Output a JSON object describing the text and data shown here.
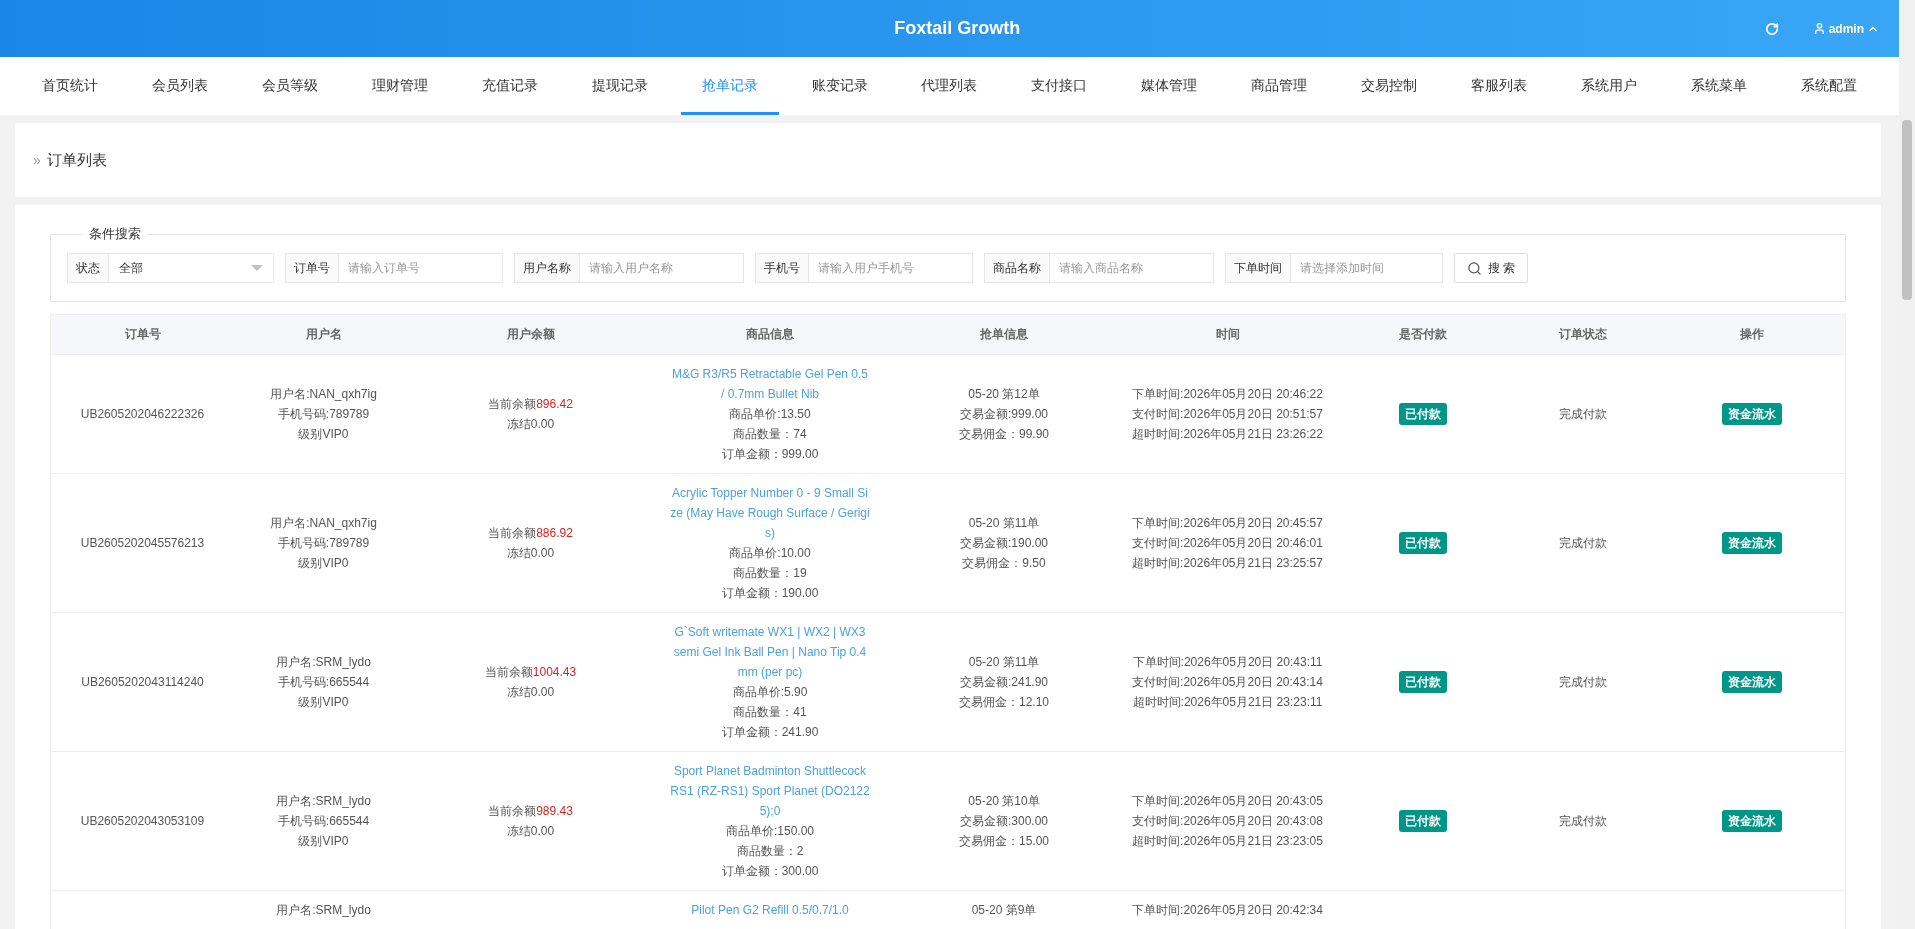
{
  "header": {
    "title": "Foxtail Growth",
    "user": "admin"
  },
  "nav": [
    {
      "label": "首页统计",
      "selected": false
    },
    {
      "label": "会员列表",
      "selected": false
    },
    {
      "label": "会员等级",
      "selected": false
    },
    {
      "label": "理财管理",
      "selected": false
    },
    {
      "label": "充值记录",
      "selected": false
    },
    {
      "label": "提现记录",
      "selected": false
    },
    {
      "label": "抢单记录",
      "selected": true
    },
    {
      "label": "账变记录",
      "selected": false
    },
    {
      "label": "代理列表",
      "selected": false
    },
    {
      "label": "支付接口",
      "selected": false
    },
    {
      "label": "媒体管理",
      "selected": false
    },
    {
      "label": "商品管理",
      "selected": false
    },
    {
      "label": "交易控制",
      "selected": false
    },
    {
      "label": "客服列表",
      "selected": false
    },
    {
      "label": "系统用户",
      "selected": false
    },
    {
      "label": "系统菜单",
      "selected": false
    },
    {
      "label": "系统配置",
      "selected": false
    }
  ],
  "page_title": {
    "mark": "»",
    "text": "订单列表"
  },
  "search": {
    "legend": "条件搜索",
    "button": "搜 索",
    "fields": [
      {
        "kind": "select",
        "label": "状态",
        "value": "全部"
      },
      {
        "kind": "input",
        "label": "订单号",
        "placeholder": "请输入订单号"
      },
      {
        "kind": "input",
        "label": "用户名称",
        "placeholder": "请输入用户名称"
      },
      {
        "kind": "input",
        "label": "手机号",
        "placeholder": "请输入用户手机号"
      },
      {
        "kind": "input",
        "label": "商品名称",
        "placeholder": "请输入商品名称"
      },
      {
        "kind": "input",
        "label": "下单时间",
        "placeholder": "请选择添加时间"
      }
    ]
  },
  "table": {
    "columns": [
      "订单号",
      "用户名",
      "用户余额",
      "商品信息",
      "抢单信息",
      "时间",
      "是否付款",
      "订单状态",
      "操作"
    ],
    "rows": [
      {
        "order_no": "UB2605202046222326",
        "user": [
          "用户名:NAN_qxh7ig",
          "手机号码:789789",
          "级别VIP0"
        ],
        "balance_label": "当前余额",
        "balance": "896.42",
        "frozen": "冻结0.00",
        "product_title": "M&G R3/R5 Retractable Gel Pen 0.5 / 0.7mm Bullet Nib",
        "product": [
          "商品单价:13.50",
          "商品数量：74",
          "订单金额：999.00"
        ],
        "grab": [
          "05-20 第12单",
          "交易金额:999.00",
          "交易佣金：99.90"
        ],
        "times": [
          "下单时间:2026年05月20日 20:46:22",
          "支付时间:2026年05月20日 20:51:57",
          "超时时间:2026年05月21日 23:26:22"
        ],
        "paid": "已付款",
        "status": "完成付款",
        "action": "资金流水"
      },
      {
        "order_no": "UB2605202045576213",
        "user": [
          "用户名:NAN_qxh7ig",
          "手机号码:789789",
          "级别VIP0"
        ],
        "balance_label": "当前余额",
        "balance": "886.92",
        "frozen": "冻结0.00",
        "product_title": "Acrylic Topper Number 0 - 9 Small Size (May Have Rough Surface / Gerigis)",
        "product": [
          "商品单价:10.00",
          "商品数量：19",
          "订单金额：190.00"
        ],
        "grab": [
          "05-20 第11单",
          "交易金额:190.00",
          "交易佣金：9.50"
        ],
        "times": [
          "下单时间:2026年05月20日 20:45:57",
          "支付时间:2026年05月20日 20:46:01",
          "超时时间:2026年05月21日 23:25:57"
        ],
        "paid": "已付款",
        "status": "完成付款",
        "action": "资金流水"
      },
      {
        "order_no": "UB2605202043114240",
        "user": [
          "用户名:SRM_lydo",
          "手机号码:665544",
          "级别VIP0"
        ],
        "balance_label": "当前余额",
        "balance": "1004.43",
        "frozen": "冻结0.00",
        "product_title": "G`Soft writemate WX1 | WX2 | WX3 semi Gel Ink Ball Pen | Nano Tip 0.4mm (per pc)",
        "product": [
          "商品单价:5.90",
          "商品数量：41",
          "订单金额：241.90"
        ],
        "grab": [
          "05-20 第11单",
          "交易金额:241.90",
          "交易佣金：12.10"
        ],
        "times": [
          "下单时间:2026年05月20日 20:43:11",
          "支付时间:2026年05月20日 20:43:14",
          "超时时间:2026年05月21日 23:23:11"
        ],
        "paid": "已付款",
        "status": "完成付款",
        "action": "资金流水"
      },
      {
        "order_no": "UB2605202043053109",
        "user": [
          "用户名:SRM_lydo",
          "手机号码:665544",
          "级别VIP0"
        ],
        "balance_label": "当前余额",
        "balance": "989.43",
        "frozen": "冻结0.00",
        "product_title": "Sport Planet Badminton Shuttlecock RS1 (RZ-RS1) Sport Planet (DO21225);0",
        "product": [
          "商品单价:150.00",
          "商品数量：2",
          "订单金额：300.00"
        ],
        "grab": [
          "05-20 第10单",
          "交易金额:300.00",
          "交易佣金：15.00"
        ],
        "times": [
          "下单时间:2026年05月20日 20:43:05",
          "支付时间:2026年05月20日 20:43:08",
          "超时时间:2026年05月21日 23:23:05"
        ],
        "paid": "已付款",
        "status": "完成付款",
        "action": "资金流水"
      },
      {
        "user": [
          "用户名:SRM_lydo"
        ],
        "product_title": "Pilot Pen G2 Refill 0.5/0.7/1.0",
        "grab": [
          "05-20 第9单"
        ],
        "times": [
          "下单时间:2026年05月20日 20:42:34"
        ]
      }
    ]
  }
}
